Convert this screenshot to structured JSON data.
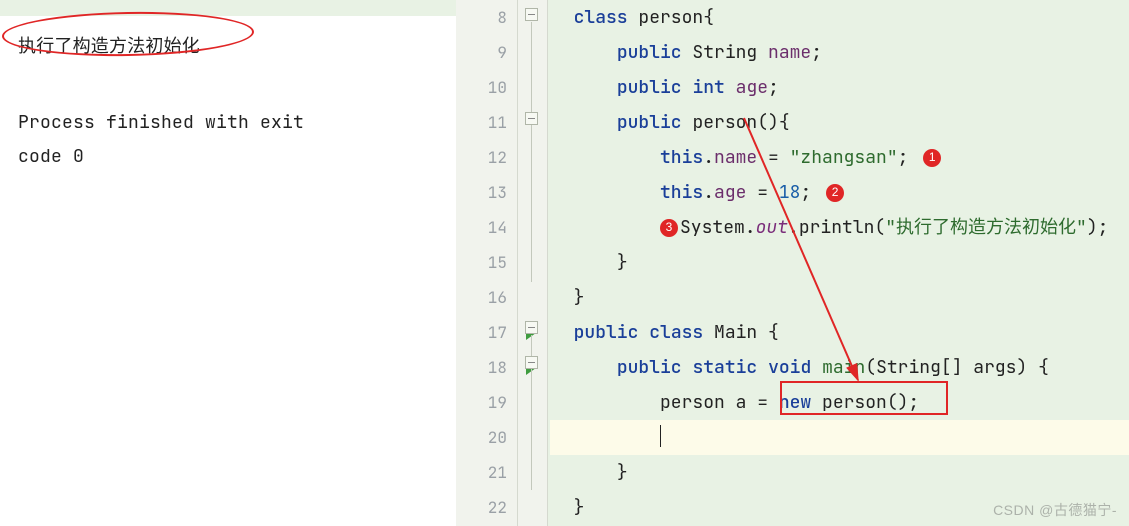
{
  "console": {
    "line1": "执行了构造方法初始化",
    "exit_msg_l1": "Process finished with exit",
    "exit_msg_l2": " code 0"
  },
  "editor": {
    "line_numbers": [
      "8",
      "9",
      "10",
      "11",
      "12",
      "13",
      "14",
      "15",
      "16",
      "17",
      "18",
      "19",
      "20",
      "21",
      "22"
    ],
    "lines": {
      "l8": {
        "indent": "  ",
        "t1": "class",
        "t2": " person{"
      },
      "l9": {
        "indent": "      ",
        "t1": "public",
        "t2": " String ",
        "t3": "name",
        "t4": ";"
      },
      "l10": {
        "indent": "      ",
        "t1": "public",
        "t2": " ",
        "t3": "int",
        "t4": " ",
        "t5": "age",
        "t6": ";"
      },
      "l11": {
        "indent": "      ",
        "t1": "public",
        "t2": " ",
        "t3": "person",
        "t4": "(){"
      },
      "l12": {
        "indent": "          ",
        "t1": "this",
        "t2": ".",
        "t3": "name",
        "t4": " = ",
        "t5": "\"zhangsan\"",
        "t6": ";"
      },
      "l13": {
        "indent": "          ",
        "t1": "this",
        "t2": ".",
        "t3": "age",
        "t4": " = ",
        "t5": "18",
        "t6": ";"
      },
      "l14": {
        "indent": "          ",
        "t1": "System.",
        "t2": "out",
        "t3": ".println(",
        "t4": "\"执行了构造方法初始化\"",
        "t5": ");"
      },
      "l15": {
        "indent": "      ",
        "t1": "}"
      },
      "l16": {
        "indent": "  ",
        "t1": "}"
      },
      "l17": {
        "indent": "  ",
        "t1": "public",
        "t2": " ",
        "t3": "class",
        "t4": " Main {"
      },
      "l18": {
        "indent": "      ",
        "t1": "public",
        "t2": " ",
        "t3": "static",
        "t4": " ",
        "t5": "void",
        "t6": " ",
        "t7": "main",
        "t8": "(String[] args) {"
      },
      "l19": {
        "indent": "          ",
        "t1": "person a = ",
        "t2": "new",
        "t3": " person();"
      },
      "l20": {
        "indent": "          ",
        "t1": ""
      },
      "l21": {
        "indent": "      ",
        "t1": "}"
      },
      "l22": {
        "indent": "  ",
        "t1": "}"
      }
    }
  },
  "annotations": {
    "badge1": "1",
    "badge2": "2",
    "badge3": "3"
  },
  "watermark": "CSDN @古德猫宁-"
}
